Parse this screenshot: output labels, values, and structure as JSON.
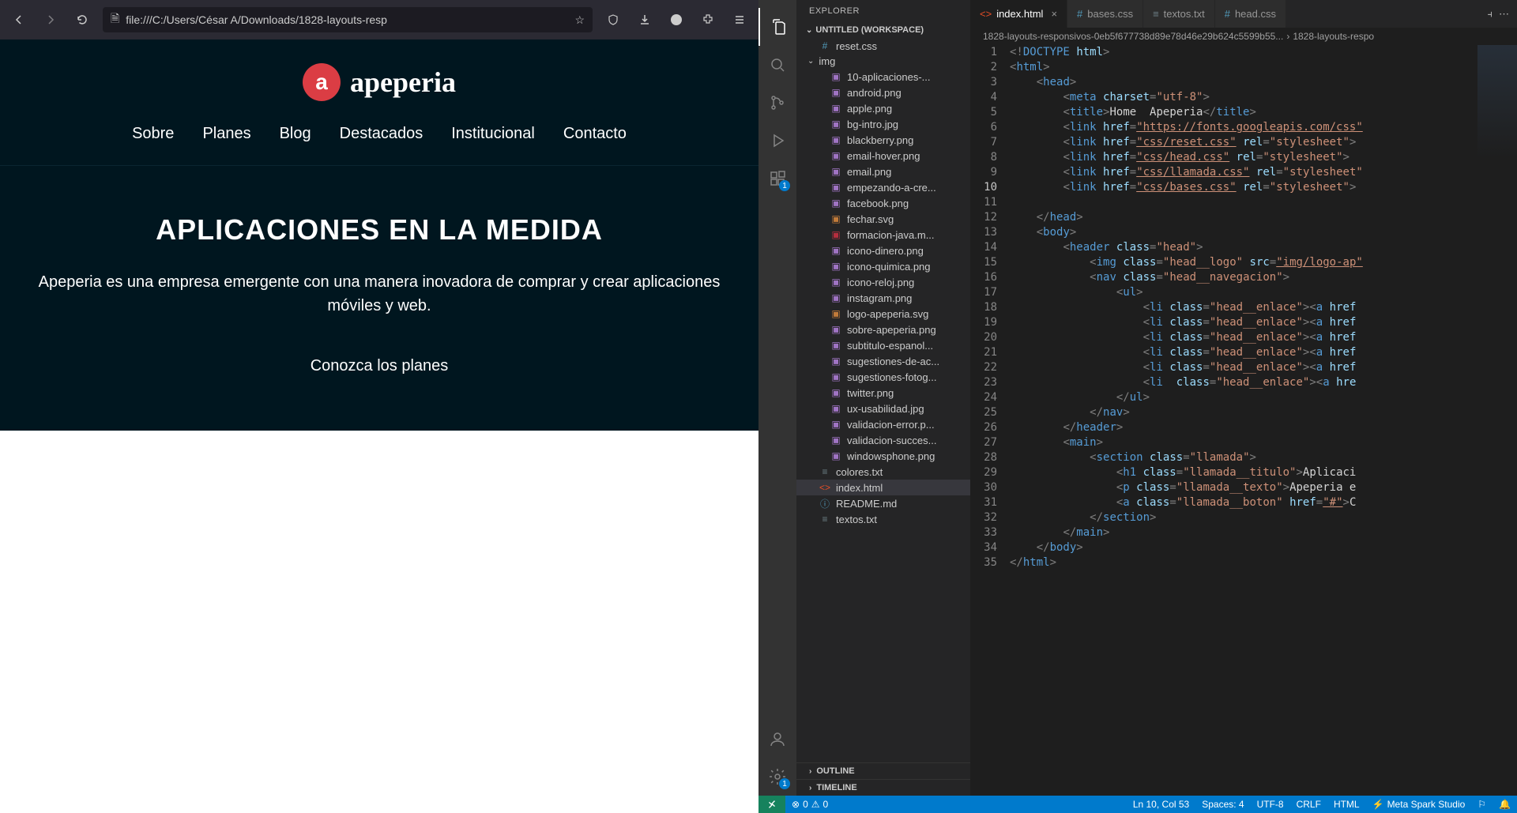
{
  "browser": {
    "url": "file:///C:/Users/César A/Downloads/1828-layouts-resp",
    "page": {
      "logo_text": "apeperia",
      "logo_letter": "a",
      "nav": [
        "Sobre",
        "Planes",
        "Blog",
        "Destacados",
        "Institucional",
        "Contacto"
      ],
      "hero_title": "APLICACIONES EN LA MEDIDA",
      "hero_text": "Apeperia es una empresa emergente con una manera inovadora de comprar y crear aplicaciones móviles y web.",
      "hero_cta": "Conozca los planes"
    }
  },
  "vscode": {
    "explorer_title": "EXPLORER",
    "workspace": "UNTITLED (WORKSPACE)",
    "outline": "OUTLINE",
    "timeline": "TIMELINE",
    "files": {
      "reset": "reset.css",
      "img_folder": "img",
      "img": [
        "10-aplicaciones-...",
        "android.png",
        "apple.png",
        "bg-intro.jpg",
        "blackberry.png",
        "email-hover.png",
        "email.png",
        "empezando-a-cre...",
        "facebook.png",
        "fechar.svg",
        "formacion-java.m...",
        "icono-dinero.png",
        "icono-quimica.png",
        "icono-reloj.png",
        "instagram.png",
        "logo-apeperia.svg",
        "sobre-apeperia.png",
        "subtitulo-espanol...",
        "sugestiones-de-ac...",
        "sugestiones-fotog...",
        "twitter.png",
        "ux-usabilidad.jpg",
        "validacion-error.p...",
        "validacion-succes...",
        "windowsphone.png"
      ],
      "root": [
        "colores.txt",
        "index.html",
        "README.md",
        "textos.txt"
      ]
    },
    "tabs": [
      {
        "name": "index.html",
        "icon": "html",
        "active": true
      },
      {
        "name": "bases.css",
        "icon": "css",
        "active": false
      },
      {
        "name": "textos.txt",
        "icon": "txt",
        "active": false
      },
      {
        "name": "head.css",
        "icon": "css",
        "active": false
      }
    ],
    "breadcrumb": {
      "folder": "1828-layouts-responsivos-0eb5f677738d89e78d46e29b624c5599b55...",
      "file": "1828-layouts-respo"
    },
    "current_line": 10,
    "code": {
      "title_text": "Home  Apeperia",
      "links": {
        "fonts": "https://fonts.googleapis.com/css",
        "reset": "css/reset.css",
        "head": "css/head.css",
        "llamada": "css/llamada.css",
        "bases": "css/bases.css"
      },
      "img_src": "img/logo-ap",
      "h1_text": "Aplicaci",
      "p_text": "Apeperia e",
      "a_text": "C"
    },
    "status": {
      "errors": "0",
      "warnings": "0",
      "position": "Ln 10, Col 53",
      "spaces": "Spaces: 4",
      "encoding": "UTF-8",
      "eol": "CRLF",
      "lang": "HTML",
      "ext": "Meta Spark Studio"
    },
    "ext_badge": "1"
  }
}
